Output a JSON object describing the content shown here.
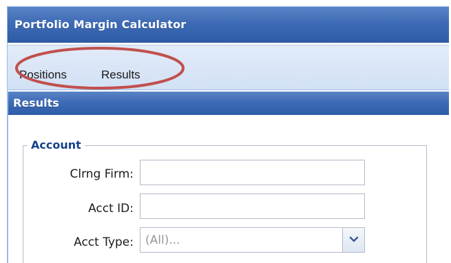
{
  "app": {
    "title": "Portfolio Margin Calculator"
  },
  "toolbar": {
    "items": [
      {
        "label": "Positions"
      },
      {
        "label": "Results"
      }
    ]
  },
  "panel": {
    "title": "Results",
    "fieldset": {
      "legend": "Account",
      "fields": [
        {
          "label": "Clrng Firm:",
          "value": ""
        },
        {
          "label": "Acct ID:",
          "value": ""
        },
        {
          "label": "Acct Type:",
          "value": "(All)..."
        }
      ]
    }
  },
  "icons": {
    "combo_trigger": "chevron-down-icon"
  },
  "colors": {
    "header_blue": "#3e6bb5",
    "toolbar_bg": "#d2e1f5",
    "legend_text": "#15428b",
    "highlight": "#c0504d"
  }
}
